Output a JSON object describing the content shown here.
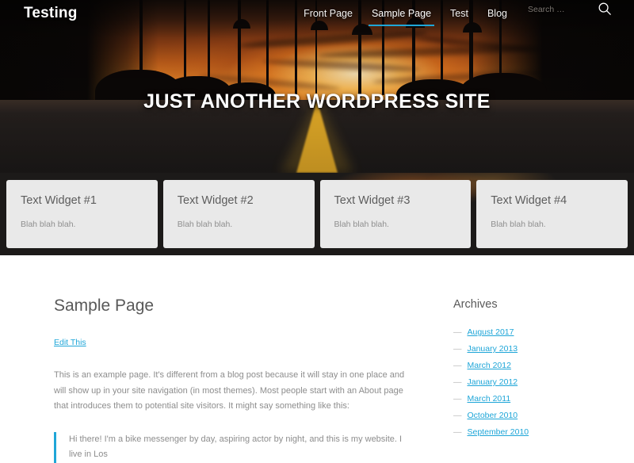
{
  "header": {
    "site_title": "Testing",
    "nav_items": [
      {
        "label": "Front Page",
        "active": false
      },
      {
        "label": "Sample Page",
        "active": true
      },
      {
        "label": "Test",
        "active": false
      },
      {
        "label": "Blog",
        "active": false
      }
    ],
    "search_placeholder": "Search …",
    "search_value": "",
    "search_icon": "search-icon"
  },
  "hero": {
    "title": "JUST ANOTHER WORDPRESS SITE"
  },
  "widgets": [
    {
      "title": "Text Widget #1",
      "text": "Blah blah blah."
    },
    {
      "title": "Text Widget #2",
      "text": "Blah blah blah."
    },
    {
      "title": "Text Widget #3",
      "text": "Blah blah blah."
    },
    {
      "title": "Text Widget #4",
      "text": "Blah blah blah."
    }
  ],
  "main": {
    "page_title": "Sample Page",
    "edit_link": "Edit This",
    "paragraph": "This is an example page. It's different from a blog post because it will stay in one place and will show up in your site navigation (in most themes). Most people start with an About page that introduces them to potential site visitors. It might say something like this:",
    "blockquote": "Hi there! I'm a bike messenger by day, aspiring actor by night, and this is my website. I live in Los"
  },
  "sidebar": {
    "title": "Archives",
    "bullet": "—",
    "items": [
      {
        "label": "August 2017"
      },
      {
        "label": "January 2013"
      },
      {
        "label": "March 2012"
      },
      {
        "label": "January 2012"
      },
      {
        "label": "March 2011"
      },
      {
        "label": "October 2010"
      },
      {
        "label": "September 2010"
      }
    ]
  },
  "colors": {
    "accent": "#1fa6d8",
    "widget_bg": "#e9e9e9",
    "strip_bg": "#1c1a19",
    "body_text": "#8d8d8d",
    "heading_text": "#595959"
  }
}
